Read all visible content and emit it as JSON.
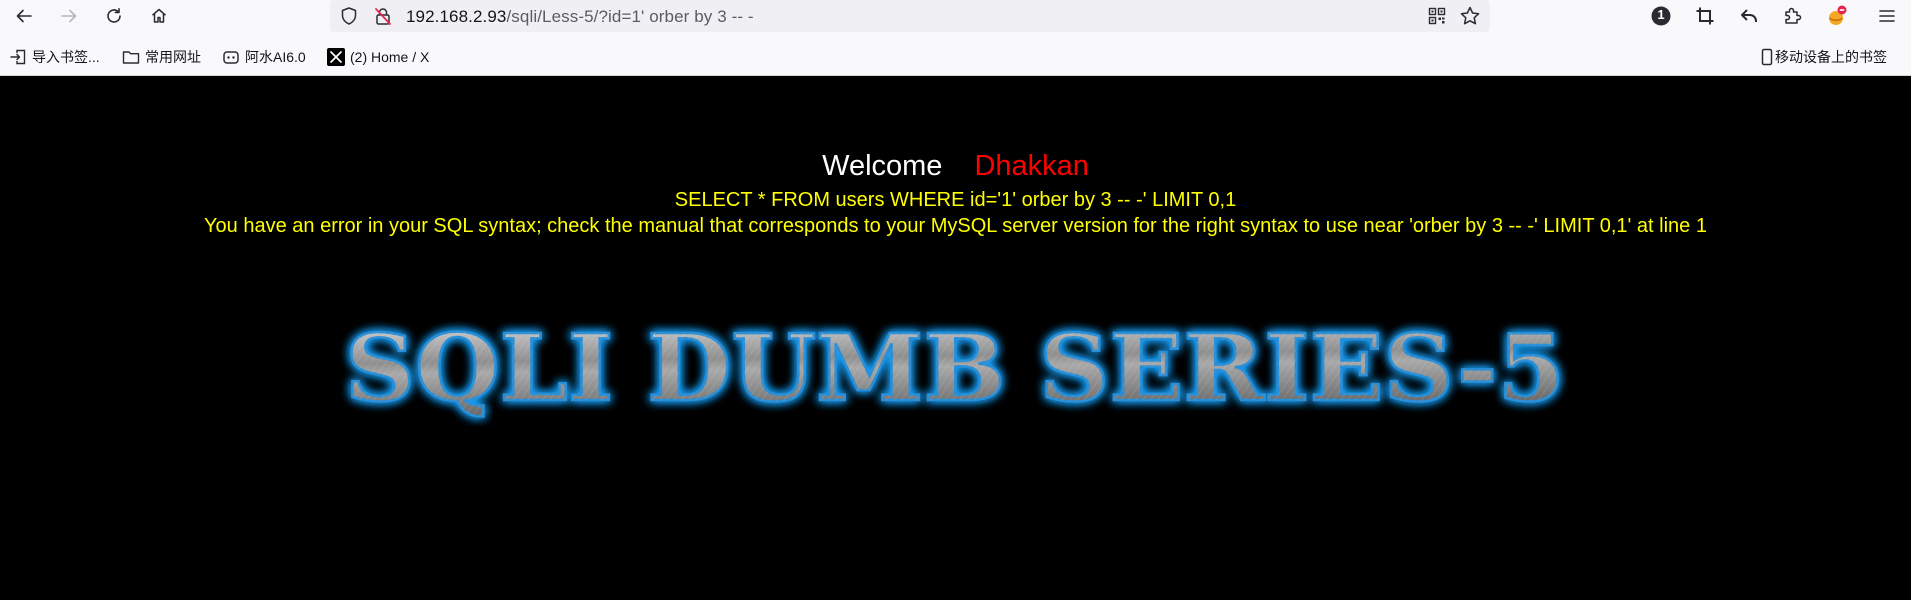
{
  "browser": {
    "url_host": "192.168.2.93",
    "url_path": "/sqli/Less-5/?id=1' orber by 3 -- -",
    "extensions_badge": "1",
    "bookmarks": [
      {
        "label": "导入书签...",
        "icon": "import-icon"
      },
      {
        "label": "常用网址",
        "icon": "folder-icon"
      },
      {
        "label": "阿水AI6.0",
        "icon": "bot-icon"
      },
      {
        "label": "(2) Home / X",
        "icon": "x-logo-icon"
      }
    ],
    "mobile_bookmarks": "移动设备上的书签"
  },
  "page": {
    "welcome_label": "Welcome",
    "welcome_name": "Dhakkan",
    "query_line": "SELECT * FROM users WHERE id='1' orber by 3 -- -' LIMIT 0,1",
    "error_line": "You have an error in your SQL syntax; check the manual that corresponds to your MySQL server version for the right syntax to use near 'orber by 3 -- -' LIMIT 0,1' at line 1",
    "banner_text": "SQLI DUMB SERIES-5"
  },
  "colors": {
    "page_background": "#000000",
    "welcome_name": "#ff0000",
    "sql_text": "#ffff00",
    "banner_glow": "#1aa3ff"
  }
}
